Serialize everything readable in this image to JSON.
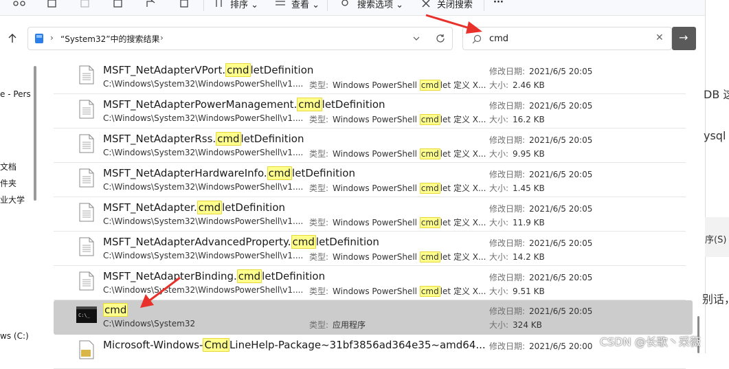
{
  "toolbar": {
    "sort_label": "排序",
    "view_label": "查看",
    "search_options_label": "搜索选项",
    "close_search_label": "关闭搜索",
    "more_label": "···"
  },
  "address": {
    "path_label": "“System32”中的搜索结果",
    "separator": "›"
  },
  "search": {
    "query": "cmd",
    "clear_glyph": "✕",
    "go_glyph": "→"
  },
  "nav_pane": {
    "items": [
      "e - Pers",
      "文档",
      "件夹",
      "业大学",
      "ws (C:)"
    ]
  },
  "labels": {
    "type_key": "类型:",
    "date_key": "修改日期:",
    "size_key": "大小:"
  },
  "highlight_color": "#ffff8c",
  "results": [
    {
      "name_pre": "MSFT_NetAdapterVPort.",
      "name_hl": "cmd",
      "name_post": "letDefinition",
      "path": "C:\\Windows\\System32\\WindowsPowerShell\\v1....",
      "type_pre": "Windows PowerShell ",
      "type_hl": "cmd",
      "type_post": "let 定义 X...",
      "date": "2021/6/5 20:05",
      "size": "2.46 KB",
      "icon": "document-icon"
    },
    {
      "name_pre": "MSFT_NetAdapterPowerManagement.",
      "name_hl": "cmd",
      "name_post": "letDefinition",
      "path": "C:\\Windows\\System32\\WindowsPowerShell\\v1....",
      "type_pre": "Windows PowerShell ",
      "type_hl": "cmd",
      "type_post": "let 定义 X...",
      "date": "2021/6/5 20:05",
      "size": "16.2 KB",
      "icon": "document-icon"
    },
    {
      "name_pre": "MSFT_NetAdapterRss.",
      "name_hl": "cmd",
      "name_post": "letDefinition",
      "path": "C:\\Windows\\System32\\WindowsPowerShell\\v1....",
      "type_pre": "Windows PowerShell ",
      "type_hl": "cmd",
      "type_post": "let 定义 X...",
      "date": "2021/6/5 20:05",
      "size": "9.95 KB",
      "icon": "document-icon"
    },
    {
      "name_pre": "MSFT_NetAdapterHardwareInfo.",
      "name_hl": "cmd",
      "name_post": "letDefinition",
      "path": "C:\\Windows\\System32\\WindowsPowerShell\\v1....",
      "type_pre": "Windows PowerShell ",
      "type_hl": "cmd",
      "type_post": "let 定义 X...",
      "date": "2021/6/5 20:05",
      "size": "1.45 KB",
      "icon": "document-icon"
    },
    {
      "name_pre": "MSFT_NetAdapter.",
      "name_hl": "cmd",
      "name_post": "letDefinition",
      "path": "C:\\Windows\\System32\\WindowsPowerShell\\v1....",
      "type_pre": "Windows PowerShell ",
      "type_hl": "cmd",
      "type_post": "let 定义 X...",
      "date": "2021/6/5 20:05",
      "size": "11.9 KB",
      "icon": "document-icon"
    },
    {
      "name_pre": "MSFT_NetAdapterAdvancedProperty.",
      "name_hl": "cmd",
      "name_post": "letDefinition",
      "path": "C:\\Windows\\System32\\WindowsPowerShell\\v1....",
      "type_pre": "Windows PowerShell ",
      "type_hl": "cmd",
      "type_post": "let 定义 X...",
      "date": "2021/6/5 20:05",
      "size": "14.2 KB",
      "icon": "document-icon"
    },
    {
      "name_pre": "MSFT_NetAdapterBinding.",
      "name_hl": "cmd",
      "name_post": "letDefinition",
      "path": "C:\\Windows\\System32\\WindowsPowerShell\\v1....",
      "type_pre": "Windows PowerShell ",
      "type_hl": "cmd",
      "type_post": "let 定义 X...",
      "date": "2021/6/5 20:05",
      "size": "9.51 KB",
      "icon": "document-icon"
    },
    {
      "name_pre": "",
      "name_hl": "cmd",
      "name_post": "",
      "path": "C:\\Windows\\System32",
      "type_pre": "应用程序",
      "type_hl": "",
      "type_post": "",
      "date": "2021/6/5 20:05",
      "size": "324 KB",
      "icon": "console-app-icon",
      "selected": true
    },
    {
      "name_pre": "Microsoft-Windows-",
      "name_hl": "Cmd",
      "name_post": "LineHelp-Package~31bf3856ad364e35~amd64...",
      "path": "",
      "type_pre": "",
      "type_hl": "",
      "type_post": "",
      "date": "2021/6/5 20:00",
      "size": "",
      "icon": "package-icon"
    }
  ],
  "background_window": {
    "fragments": [
      "DB 这",
      "ysql",
      "序(S)",
      "别话，"
    ]
  },
  "watermark": "CSDN @长歌丶采薇",
  "annotation_color": "#e8312a"
}
